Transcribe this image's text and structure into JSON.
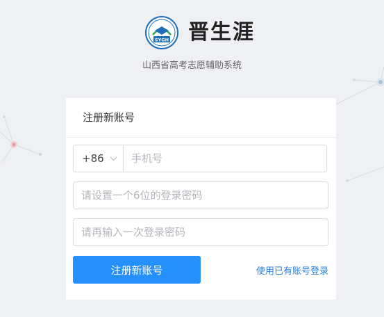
{
  "brand": {
    "logo_text": "SYGH",
    "title": "晋生涯",
    "subtitle": "山西省高考志愿辅助系统"
  },
  "register_card": {
    "title": "注册新账号",
    "country_code": "+86",
    "phone_placeholder": "手机号",
    "password_placeholder": "请设置一个6位的登录密码",
    "confirm_placeholder": "请再输入一次登录密码",
    "submit_label": "注册新账号",
    "login_link": "使用已有账号登录"
  },
  "colors": {
    "accent": "#2590f9",
    "link": "#2a7fd5",
    "background": "#eff0f4",
    "logo_ring": "#1d6fb8"
  }
}
